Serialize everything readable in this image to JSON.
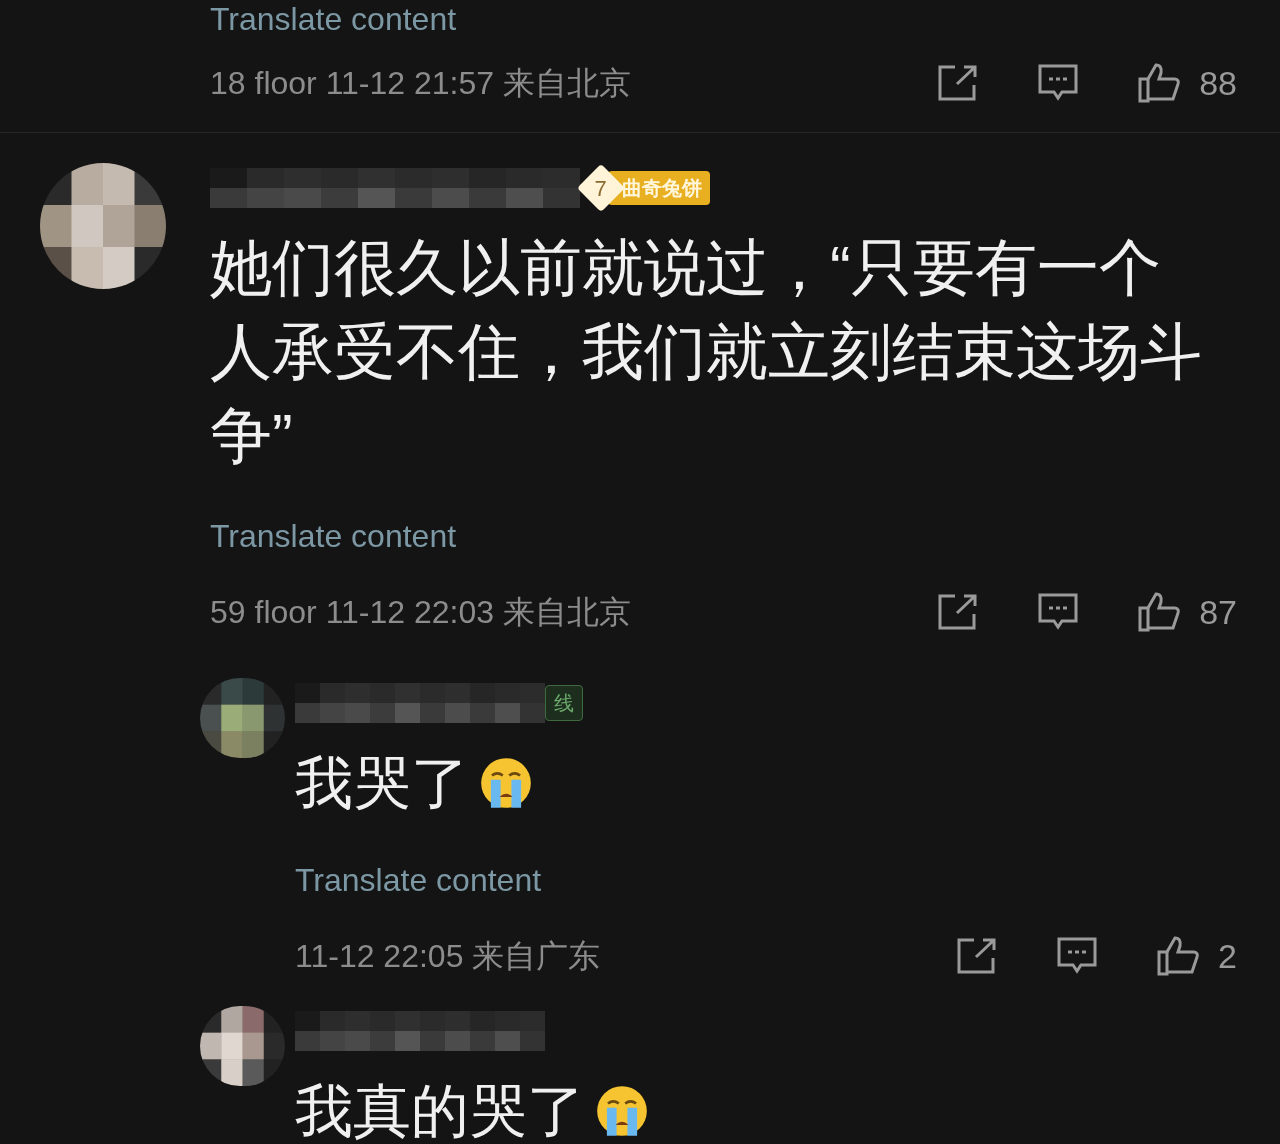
{
  "partial_comment": {
    "translate": "Translate content",
    "meta": "18 floor 11-12 21:57 来自北京",
    "likes": "88"
  },
  "comments": [
    {
      "badge": {
        "level": "7",
        "label": "曲奇兔饼"
      },
      "text": "她们很久以前就说过，“只要有一个人承受不住，我们就立刻结束这场斗争”",
      "translate": "Translate content",
      "meta": "59 floor 11-12 22:03 来自北京",
      "likes": "87",
      "children": [
        {
          "badge": {
            "label": "线"
          },
          "text": "我哭了",
          "crying_emoji": true,
          "translate": "Translate content",
          "meta": "11-12 22:05 来自广东",
          "likes": "2"
        },
        {
          "text": "我真的哭了",
          "crying_emoji": true
        }
      ]
    }
  ]
}
